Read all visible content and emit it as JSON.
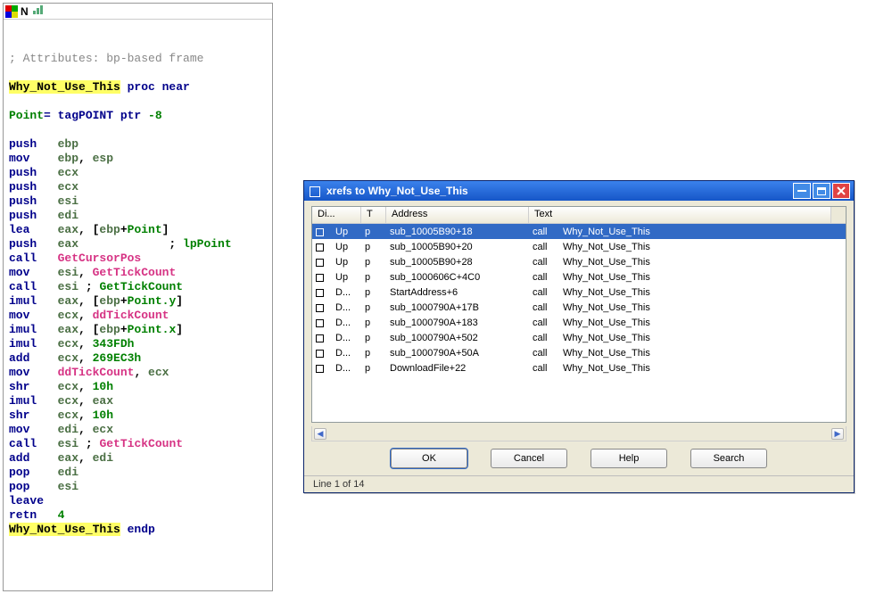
{
  "code_panel": {
    "title": "N",
    "lines": [
      {
        "segs": [
          {
            "t": "",
            "c": ""
          }
        ]
      },
      {
        "segs": [
          {
            "t": "",
            "c": ""
          }
        ]
      },
      {
        "segs": [
          {
            "t": "; Attributes: bp-based frame",
            "c": "c-cm"
          }
        ]
      },
      {
        "segs": [
          {
            "t": "",
            "c": ""
          }
        ]
      },
      {
        "segs": [
          {
            "t": "Why_Not_Use_This",
            "c": "c-name"
          },
          {
            "t": " proc near",
            "c": "c-kw"
          }
        ]
      },
      {
        "segs": [
          {
            "t": "",
            "c": ""
          }
        ]
      },
      {
        "segs": [
          {
            "t": "Point",
            "c": "c-grn"
          },
          {
            "t": "= tagPOINT ptr ",
            "c": "c-kw"
          },
          {
            "t": "-8",
            "c": "c-grn"
          }
        ]
      },
      {
        "segs": [
          {
            "t": "",
            "c": ""
          }
        ]
      },
      {
        "segs": [
          {
            "t": "push   ",
            "c": "c-ins"
          },
          {
            "t": "ebp",
            "c": "c-reg"
          }
        ]
      },
      {
        "segs": [
          {
            "t": "mov    ",
            "c": "c-ins"
          },
          {
            "t": "ebp",
            "c": "c-reg"
          },
          {
            "t": ", ",
            "c": "c-def"
          },
          {
            "t": "esp",
            "c": "c-reg"
          }
        ]
      },
      {
        "segs": [
          {
            "t": "push   ",
            "c": "c-ins"
          },
          {
            "t": "ecx",
            "c": "c-reg"
          }
        ]
      },
      {
        "segs": [
          {
            "t": "push   ",
            "c": "c-ins"
          },
          {
            "t": "ecx",
            "c": "c-reg"
          }
        ]
      },
      {
        "segs": [
          {
            "t": "push   ",
            "c": "c-ins"
          },
          {
            "t": "esi",
            "c": "c-reg"
          }
        ]
      },
      {
        "segs": [
          {
            "t": "push   ",
            "c": "c-ins"
          },
          {
            "t": "edi",
            "c": "c-reg"
          }
        ]
      },
      {
        "segs": [
          {
            "t": "lea    ",
            "c": "c-ins"
          },
          {
            "t": "eax",
            "c": "c-reg"
          },
          {
            "t": ", [",
            "c": "c-def"
          },
          {
            "t": "ebp",
            "c": "c-reg"
          },
          {
            "t": "+",
            "c": "c-def"
          },
          {
            "t": "Point",
            "c": "c-grn"
          },
          {
            "t": "]",
            "c": "c-def"
          }
        ]
      },
      {
        "segs": [
          {
            "t": "push   ",
            "c": "c-ins"
          },
          {
            "t": "eax",
            "c": "c-reg"
          },
          {
            "t": "             ; ",
            "c": "c-def"
          },
          {
            "t": "lpPoint",
            "c": "c-grn"
          }
        ]
      },
      {
        "segs": [
          {
            "t": "call   ",
            "c": "c-ins"
          },
          {
            "t": "GetCursorPos",
            "c": "c-mag"
          }
        ]
      },
      {
        "segs": [
          {
            "t": "mov    ",
            "c": "c-ins"
          },
          {
            "t": "esi",
            "c": "c-reg"
          },
          {
            "t": ", ",
            "c": "c-def"
          },
          {
            "t": "GetTickCount",
            "c": "c-mag"
          }
        ]
      },
      {
        "segs": [
          {
            "t": "call   ",
            "c": "c-ins"
          },
          {
            "t": "esi ",
            "c": "c-reg"
          },
          {
            "t": "; ",
            "c": "c-def"
          },
          {
            "t": "GetTickCount",
            "c": "c-grn"
          }
        ]
      },
      {
        "segs": [
          {
            "t": "imul   ",
            "c": "c-ins"
          },
          {
            "t": "eax",
            "c": "c-reg"
          },
          {
            "t": ", [",
            "c": "c-def"
          },
          {
            "t": "ebp",
            "c": "c-reg"
          },
          {
            "t": "+",
            "c": "c-def"
          },
          {
            "t": "Point.y",
            "c": "c-grn"
          },
          {
            "t": "]",
            "c": "c-def"
          }
        ]
      },
      {
        "segs": [
          {
            "t": "mov    ",
            "c": "c-ins"
          },
          {
            "t": "ecx",
            "c": "c-reg"
          },
          {
            "t": ", ",
            "c": "c-def"
          },
          {
            "t": "ddTickCount",
            "c": "c-mag"
          }
        ]
      },
      {
        "segs": [
          {
            "t": "imul   ",
            "c": "c-ins"
          },
          {
            "t": "eax",
            "c": "c-reg"
          },
          {
            "t": ", [",
            "c": "c-def"
          },
          {
            "t": "ebp",
            "c": "c-reg"
          },
          {
            "t": "+",
            "c": "c-def"
          },
          {
            "t": "Point.x",
            "c": "c-grn"
          },
          {
            "t": "]",
            "c": "c-def"
          }
        ]
      },
      {
        "segs": [
          {
            "t": "imul   ",
            "c": "c-ins"
          },
          {
            "t": "ecx",
            "c": "c-reg"
          },
          {
            "t": ", ",
            "c": "c-def"
          },
          {
            "t": "343FDh",
            "c": "c-grn"
          }
        ]
      },
      {
        "segs": [
          {
            "t": "add    ",
            "c": "c-ins"
          },
          {
            "t": "ecx",
            "c": "c-reg"
          },
          {
            "t": ", ",
            "c": "c-def"
          },
          {
            "t": "269EC3h",
            "c": "c-grn"
          }
        ]
      },
      {
        "segs": [
          {
            "t": "mov    ",
            "c": "c-ins"
          },
          {
            "t": "ddTickCount",
            "c": "c-mag"
          },
          {
            "t": ", ",
            "c": "c-def"
          },
          {
            "t": "ecx",
            "c": "c-reg"
          }
        ]
      },
      {
        "segs": [
          {
            "t": "shr    ",
            "c": "c-ins"
          },
          {
            "t": "ecx",
            "c": "c-reg"
          },
          {
            "t": ", ",
            "c": "c-def"
          },
          {
            "t": "10h",
            "c": "c-grn"
          }
        ]
      },
      {
        "segs": [
          {
            "t": "imul   ",
            "c": "c-ins"
          },
          {
            "t": "ecx",
            "c": "c-reg"
          },
          {
            "t": ", ",
            "c": "c-def"
          },
          {
            "t": "eax",
            "c": "c-reg"
          }
        ]
      },
      {
        "segs": [
          {
            "t": "shr    ",
            "c": "c-ins"
          },
          {
            "t": "ecx",
            "c": "c-reg"
          },
          {
            "t": ", ",
            "c": "c-def"
          },
          {
            "t": "10h",
            "c": "c-grn"
          }
        ]
      },
      {
        "segs": [
          {
            "t": "mov    ",
            "c": "c-ins"
          },
          {
            "t": "edi",
            "c": "c-reg"
          },
          {
            "t": ", ",
            "c": "c-def"
          },
          {
            "t": "ecx",
            "c": "c-reg"
          }
        ]
      },
      {
        "segs": [
          {
            "t": "call   ",
            "c": "c-ins"
          },
          {
            "t": "esi ",
            "c": "c-reg"
          },
          {
            "t": "; ",
            "c": "c-def"
          },
          {
            "t": "GetTickCount",
            "c": "c-mag"
          }
        ]
      },
      {
        "segs": [
          {
            "t": "add    ",
            "c": "c-ins"
          },
          {
            "t": "eax",
            "c": "c-reg"
          },
          {
            "t": ", ",
            "c": "c-def"
          },
          {
            "t": "edi",
            "c": "c-reg"
          }
        ]
      },
      {
        "segs": [
          {
            "t": "pop    ",
            "c": "c-ins"
          },
          {
            "t": "edi",
            "c": "c-reg"
          }
        ]
      },
      {
        "segs": [
          {
            "t": "pop    ",
            "c": "c-ins"
          },
          {
            "t": "esi",
            "c": "c-reg"
          }
        ]
      },
      {
        "segs": [
          {
            "t": "leave",
            "c": "c-ins"
          }
        ]
      },
      {
        "segs": [
          {
            "t": "retn   ",
            "c": "c-ins"
          },
          {
            "t": "4",
            "c": "c-grn"
          }
        ]
      },
      {
        "segs": [
          {
            "t": "Why_Not_Use_This",
            "c": "c-name"
          },
          {
            "t": " endp",
            "c": "c-kw"
          }
        ]
      }
    ]
  },
  "xrefs": {
    "title": "xrefs to Why_Not_Use_This",
    "columns": {
      "dir": "Di...",
      "t": "T",
      "addr": "Address",
      "text": "Text"
    },
    "rows": [
      {
        "dir": "Up",
        "t": "p",
        "addr": "sub_10005B90+18",
        "call": "call",
        "text": "Why_Not_Use_This",
        "selected": true
      },
      {
        "dir": "Up",
        "t": "p",
        "addr": "sub_10005B90+20",
        "call": "call",
        "text": "Why_Not_Use_This"
      },
      {
        "dir": "Up",
        "t": "p",
        "addr": "sub_10005B90+28",
        "call": "call",
        "text": "Why_Not_Use_This"
      },
      {
        "dir": "Up",
        "t": "p",
        "addr": "sub_1000606C+4C0",
        "call": "call",
        "text": "Why_Not_Use_This"
      },
      {
        "dir": "D...",
        "t": "p",
        "addr": "StartAddress+6",
        "call": "call",
        "text": "Why_Not_Use_This"
      },
      {
        "dir": "D...",
        "t": "p",
        "addr": "sub_1000790A+17B",
        "call": "call",
        "text": "Why_Not_Use_This"
      },
      {
        "dir": "D...",
        "t": "p",
        "addr": "sub_1000790A+183",
        "call": "call",
        "text": "Why_Not_Use_This"
      },
      {
        "dir": "D...",
        "t": "p",
        "addr": "sub_1000790A+502",
        "call": "call",
        "text": "Why_Not_Use_This"
      },
      {
        "dir": "D...",
        "t": "p",
        "addr": "sub_1000790A+50A",
        "call": "call",
        "text": "Why_Not_Use_This"
      },
      {
        "dir": "D...",
        "t": "p",
        "addr": "DownloadFile+22",
        "call": "call",
        "text": "Why_Not_Use_This"
      }
    ],
    "buttons": {
      "ok": "OK",
      "cancel": "Cancel",
      "help": "Help",
      "search": "Search"
    },
    "status": "Line 1 of 14"
  }
}
